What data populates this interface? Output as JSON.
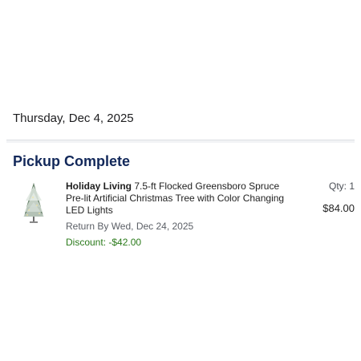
{
  "order": {
    "date": "Thursday, Dec 4, 2025",
    "status": "Pickup Complete",
    "item": {
      "brand": "Holiday Living",
      "description": "7.5-ft Flocked Greensboro Spruce Pre-lit Artificial Christmas Tree with Color Changing LED Lights",
      "return_by": "Return By Wed, Dec 24, 2025",
      "discount": "Discount: -$42.00",
      "qty": "Qty: 1",
      "price": "$84.00",
      "image_icon": "flocked-christmas-tree"
    }
  },
  "colors": {
    "status_title": "#12285a",
    "discount": "#2a7a1a",
    "page_bg": "#f2f3f5"
  }
}
